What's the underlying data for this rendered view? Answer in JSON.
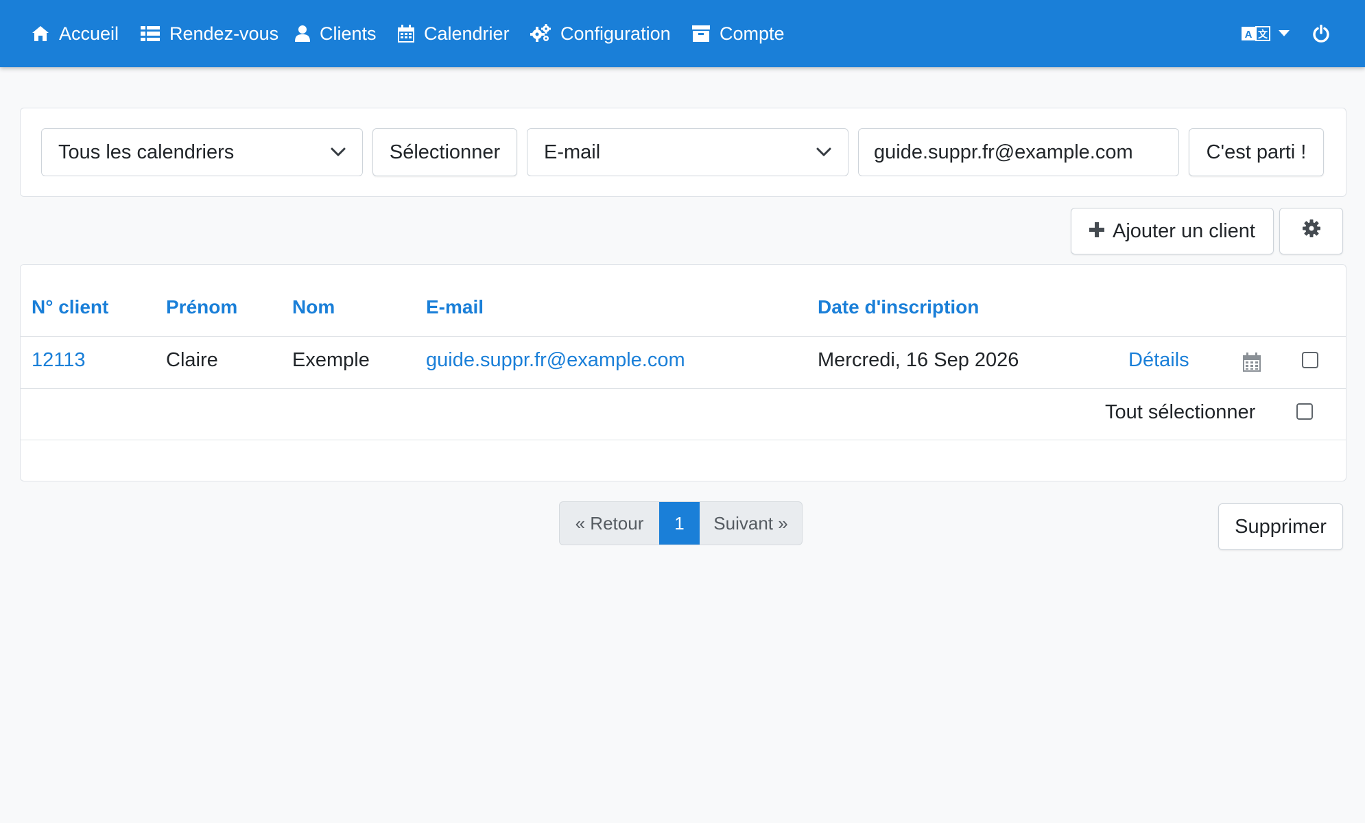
{
  "nav": {
    "items": [
      {
        "label": "Accueil",
        "icon": "home-icon"
      },
      {
        "label": "Rendez-vous",
        "icon": "list-icon"
      },
      {
        "label": "Clients",
        "icon": "user-icon"
      },
      {
        "label": "Calendrier",
        "icon": "calendar-icon"
      },
      {
        "label": "Configuration",
        "icon": "cogs-icon"
      },
      {
        "label": "Compte",
        "icon": "archive-icon"
      }
    ],
    "language_icon": "language-icon",
    "logout_icon": "power-icon"
  },
  "filter": {
    "calendar_select": "Tous les calendriers",
    "select_button": "Sélectionner",
    "field_select": "E-mail",
    "search_value": "guide.suppr.fr@example.com",
    "go_button": "C'est parti !"
  },
  "actions": {
    "add_client": "Ajouter un client"
  },
  "table": {
    "headers": [
      "N° client",
      "Prénom",
      "Nom",
      "E-mail",
      "Date d'inscription"
    ],
    "rows": [
      {
        "id": "12113",
        "first_name": "Claire",
        "last_name": "Exemple",
        "email": "guide.suppr.fr@example.com",
        "registered": "Mercredi, 16 Sep 2026",
        "details": "Détails"
      }
    ],
    "select_all": "Tout sélectionner"
  },
  "pagination": {
    "prev": "« Retour",
    "current": "1",
    "next": "Suivant »"
  },
  "delete_button": "Supprimer",
  "colors": {
    "primary": "#1a7fd8",
    "background": "#f8f9fa"
  }
}
